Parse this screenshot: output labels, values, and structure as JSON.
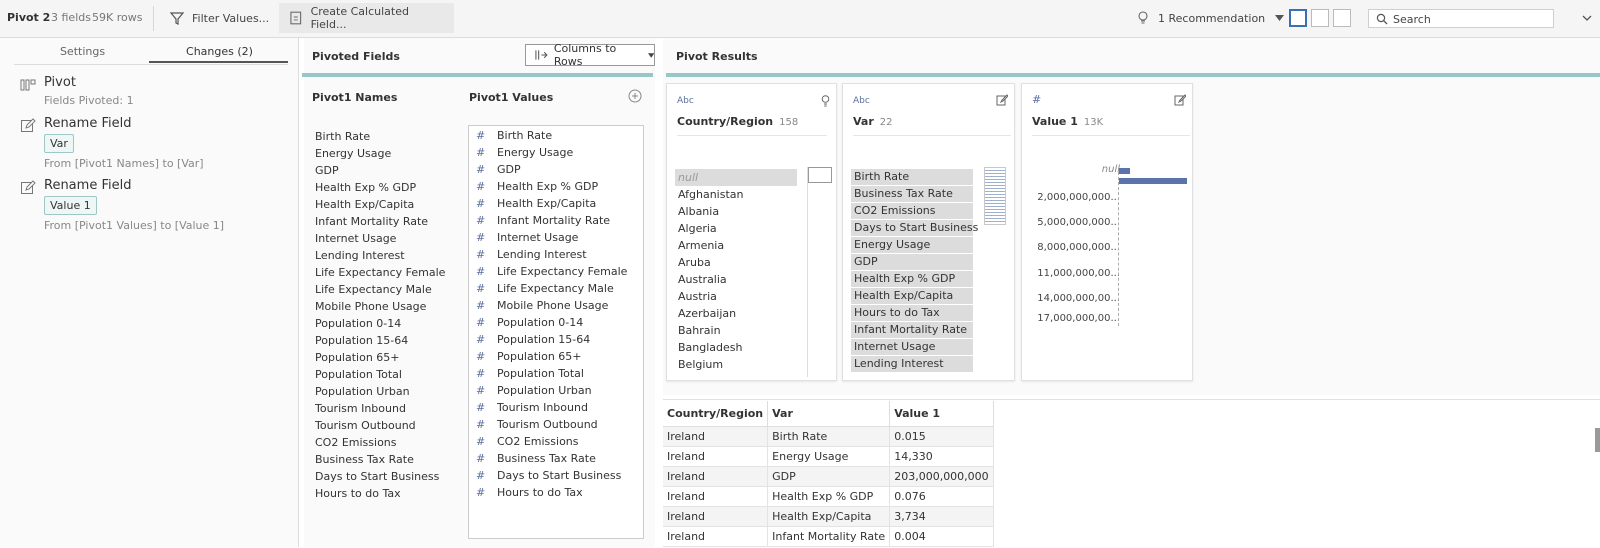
{
  "topbar": {
    "step_name": "Pivot 2",
    "fields_count": "3 fields",
    "rows_count": "59K rows",
    "filter_label": "Filter Values...",
    "calc_label": "Create Calculated Field...",
    "recommendation_label": "1 Recommendation",
    "search_placeholder": "Search"
  },
  "left_panel": {
    "tabs": [
      "Settings",
      "Changes (2)"
    ],
    "changes": [
      {
        "title": "Pivot",
        "detail": "Fields Pivoted: 1"
      },
      {
        "title": "Rename Field",
        "chip": "Var",
        "detail": "From [Pivot1 Names] to [Var]"
      },
      {
        "title": "Rename Field",
        "chip": "Value 1",
        "detail": "From [Pivot1 Values] to [Value 1]"
      }
    ]
  },
  "pivoted_fields": {
    "header": "Pivoted Fields",
    "dropdown": "Columns to Rows",
    "names_title": "Pivot1 Names",
    "values_title": "Pivot1 Values",
    "names": [
      "Birth Rate",
      "Energy Usage",
      "GDP",
      "Health Exp % GDP",
      "Health Exp/Capita",
      "Infant Mortality Rate",
      "Internet Usage",
      "Lending Interest",
      "Life Expectancy Female",
      "Life Expectancy Male",
      "Mobile Phone Usage",
      "Population 0-14",
      "Population 15-64",
      "Population 65+",
      "Population Total",
      "Population Urban",
      "Tourism Inbound",
      "Tourism Outbound",
      "CO2 Emissions",
      "Business Tax Rate",
      "Days to Start Business",
      "Hours to do Tax"
    ],
    "values": [
      "Birth Rate",
      "Energy Usage",
      "GDP",
      "Health Exp % GDP",
      "Health Exp/Capita",
      "Infant Mortality Rate",
      "Internet Usage",
      "Lending Interest",
      "Life Expectancy Female",
      "Life Expectancy Male",
      "Mobile Phone Usage",
      "Population 0-14",
      "Population 15-64",
      "Population 65+",
      "Population Total",
      "Population Urban",
      "Tourism Inbound",
      "Tourism Outbound",
      "CO2 Emissions",
      "Business Tax Rate",
      "Days to Start Business",
      "Hours to do Tax"
    ]
  },
  "pivot_results": {
    "header": "Pivot Results",
    "cards": [
      {
        "type": "Abc",
        "name": "Country/Region",
        "count": "158",
        "items": [
          "null",
          "Afghanistan",
          "Albania",
          "Algeria",
          "Armenia",
          "Aruba",
          "Australia",
          "Austria",
          "Azerbaijan",
          "Bahrain",
          "Bangladesh",
          "Belgium"
        ]
      },
      {
        "type": "Abc",
        "name": "Var",
        "count": "22",
        "items": [
          "Birth Rate",
          "Business Tax Rate",
          "CO2 Emissions",
          "Days to Start Business",
          "Energy Usage",
          "GDP",
          "Health Exp % GDP",
          "Health Exp/Capita",
          "Hours to do Tax",
          "Infant Mortality Rate",
          "Internet Usage",
          "Lending Interest"
        ]
      },
      {
        "type": "#",
        "name": "Value 1",
        "count": "13K",
        "bins": [
          "null",
          "2,000,000,000...",
          "5,000,000,000...",
          "8,000,000,000...",
          "11,000,000,00...",
          "14,000,000,00...",
          "17,000,000,00..."
        ]
      }
    ],
    "table": {
      "columns": [
        "Country/Region",
        "Var",
        "Value 1"
      ],
      "rows": [
        [
          "Ireland",
          "Birth Rate",
          "0.015"
        ],
        [
          "Ireland",
          "Energy Usage",
          "14,330"
        ],
        [
          "Ireland",
          "GDP",
          "203,000,000,000"
        ],
        [
          "Ireland",
          "Health Exp % GDP",
          "0.076"
        ],
        [
          "Ireland",
          "Health Exp/Capita",
          "3,734"
        ],
        [
          "Ireland",
          "Infant Mortality Rate",
          "0.004"
        ]
      ]
    }
  },
  "colors": {
    "teal": "#95c8c6",
    "bar": "#5a73a8",
    "accent": "#3a6fb4"
  }
}
